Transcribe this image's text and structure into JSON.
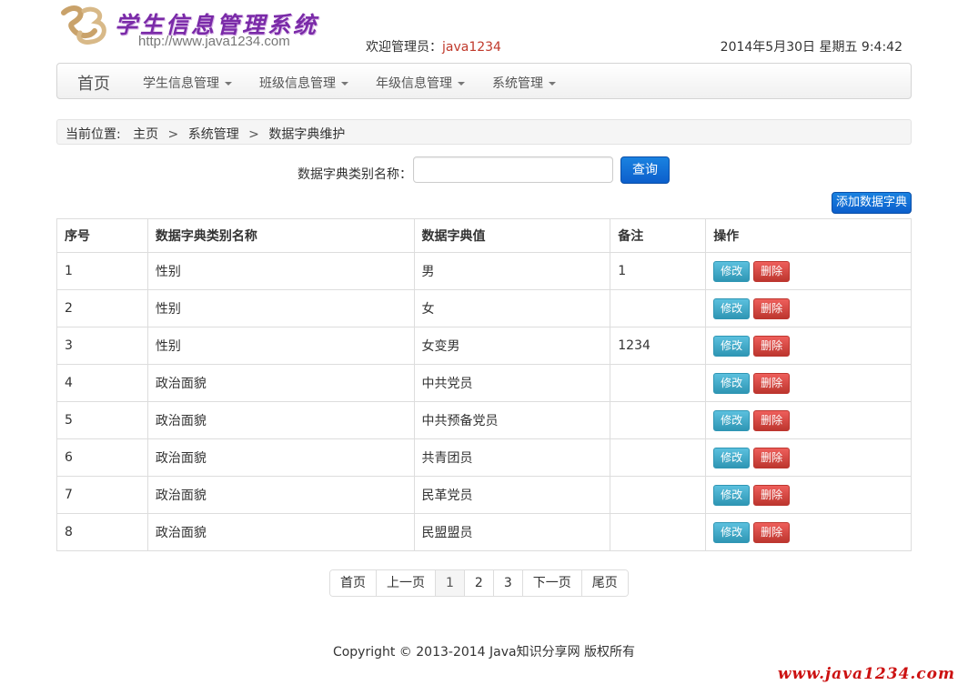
{
  "header": {
    "logo_title": "学生信息管理系统",
    "logo_url": "http://www.java1234.com",
    "welcome_label": "欢迎管理员：",
    "welcome_user": "java1234",
    "datetime": "2014年5月30日 星期五 9:4:42"
  },
  "nav": {
    "home": "首页",
    "items": [
      {
        "label": "学生信息管理"
      },
      {
        "label": "班级信息管理"
      },
      {
        "label": "年级信息管理"
      },
      {
        "label": "系统管理"
      }
    ]
  },
  "breadcrumb": {
    "label": "当前位置:",
    "items": [
      "主页",
      "系统管理",
      "数据字典维护"
    ],
    "separator": ">"
  },
  "search": {
    "label": "数据字典类别名称：",
    "value": "",
    "button": "查询"
  },
  "add_button": "添加数据字典",
  "table": {
    "headers": [
      "序号",
      "数据字典类别名称",
      "数据字典值",
      "备注",
      "操作"
    ],
    "rows": [
      [
        "1",
        "性别",
        "男",
        "1"
      ],
      [
        "2",
        "性别",
        "女",
        ""
      ],
      [
        "3",
        "性别",
        "女变男",
        "1234"
      ],
      [
        "4",
        "政治面貌",
        "中共党员",
        ""
      ],
      [
        "5",
        "政治面貌",
        "中共预备党员",
        ""
      ],
      [
        "6",
        "政治面貌",
        "共青团员",
        ""
      ],
      [
        "7",
        "政治面貌",
        "民革党员",
        ""
      ],
      [
        "8",
        "政治面貌",
        "民盟盟员",
        ""
      ]
    ],
    "edit_label": "修改",
    "delete_label": "删除"
  },
  "pagination": [
    "首页",
    "上一页",
    "1",
    "2",
    "3",
    "下一页",
    "尾页"
  ],
  "pagination_active": "1",
  "footer": "Copyright © 2013-2014 Java知识分享网 版权所有",
  "watermark": "www.java1234.com",
  "colors": {
    "primary": "#0c5fcc",
    "edit": "#2f96b4",
    "delete": "#bd362f",
    "brand": "#7a2aa8",
    "watermark": "#cc1111"
  }
}
